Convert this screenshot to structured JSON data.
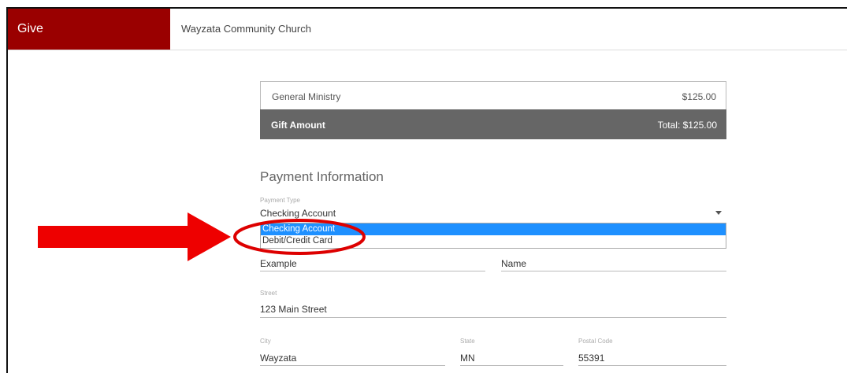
{
  "header": {
    "give_label": "Give",
    "church_name": "Wayzata Community Church"
  },
  "summary": {
    "fund_label": "General Ministry",
    "fund_amount": "$125.00",
    "gift_label": "Gift Amount",
    "total_label": "Total: $125.00"
  },
  "payment": {
    "section_title": "Payment Information",
    "type_label": "Payment Type",
    "type_value": "Checking Account",
    "options": [
      "Checking Account",
      "Debit/Credit Card"
    ]
  },
  "name": {
    "first_value": "Example",
    "last_value": "Name"
  },
  "address": {
    "street_label": "Street",
    "street_value": "123 Main Street",
    "city_label": "City",
    "city_value": "Wayzata",
    "state_label": "State",
    "state_value": "MN",
    "postal_label": "Postal Code",
    "postal_value": "55391"
  },
  "annotation": {
    "arrow_color": "#ee0000",
    "circle_color": "#dd0000"
  },
  "colors": {
    "brand": "#9a0000",
    "highlight": "#1e90ff"
  }
}
